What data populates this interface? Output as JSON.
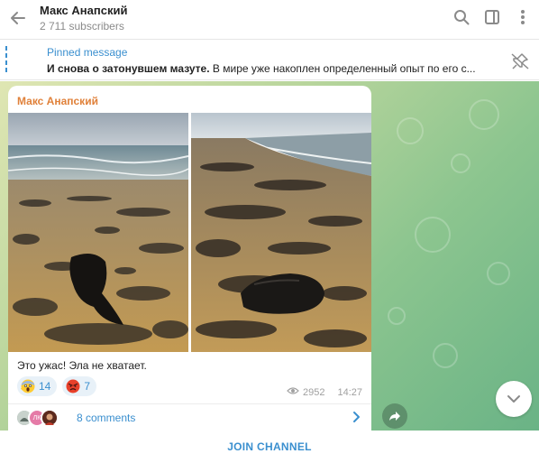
{
  "header": {
    "title": "Макс Анапский",
    "subscribers": "2 711 subscribers"
  },
  "pinned": {
    "title": "Pinned message",
    "bold": "И снова о затонувшем мазуте.",
    "text": " В мире уже накоплен определенный опыт по его с..."
  },
  "post": {
    "author": "Макс Анапский",
    "text": "Это ужас! Эла не хватает.",
    "reactions": [
      {
        "emoji": "scream",
        "count": "14"
      },
      {
        "emoji": "angry",
        "count": "7"
      }
    ],
    "views": "2952",
    "time": "14:27",
    "comments": "8 comments",
    "avatar_initials": "ЛК"
  },
  "footer": {
    "join": "JOIN CHANNEL"
  },
  "colors": {
    "accent": "#3a8fcf",
    "author": "#e0813a"
  }
}
